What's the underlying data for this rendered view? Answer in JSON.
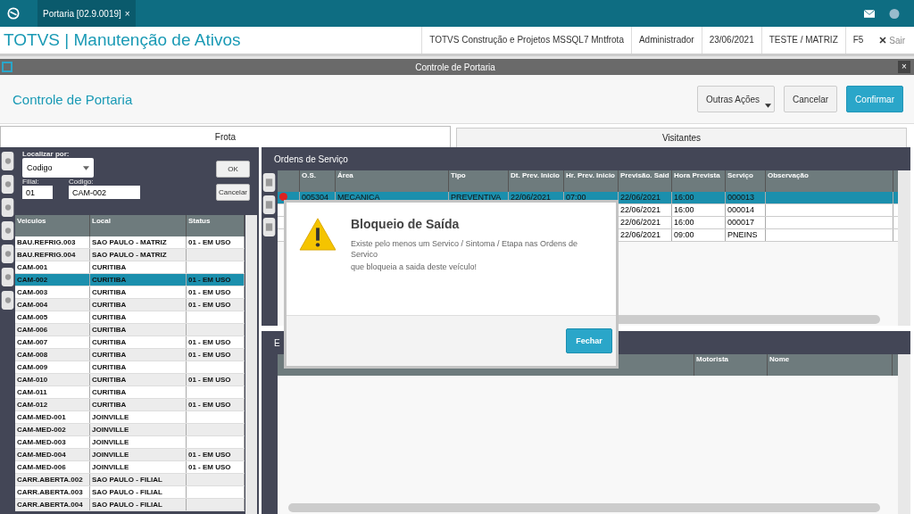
{
  "app_bar": {
    "tab": "Portaria [02.9.0019]",
    "tab_close": "×"
  },
  "header": {
    "title": "TOTVS | Manutenção de Ativos",
    "info": [
      "TOTVS Construção e Projetos MSSQL7 Mntfrota",
      "Administrador",
      "23/06/2021",
      "TESTE / MATRIZ",
      "F5"
    ],
    "exit": "Sair"
  },
  "window": {
    "title": "Controle de Portaria",
    "close": "×"
  },
  "toolbar": {
    "title": "Controle de Portaria",
    "buttons": [
      {
        "label": "Outras Ações",
        "kind": "menu"
      },
      {
        "label": "Cancelar",
        "kind": "plain"
      },
      {
        "label": "Confirmar",
        "kind": "primary"
      }
    ]
  },
  "tabs": [
    {
      "label": "Frota",
      "selected": true
    },
    {
      "label": "Visitantes",
      "selected": false
    }
  ],
  "search": {
    "label": "Localizar por:",
    "by": "Codigo",
    "filial_label": "Filial:",
    "filial": "01",
    "codigo_label": "Codigo:",
    "codigo": "CAM-002",
    "ok": "OK",
    "cancel": "Cancelar"
  },
  "vehicles": {
    "columns": [
      "Veiculos",
      "Local",
      "Status"
    ],
    "rows": [
      {
        "cells": [
          "BAU.REFRIG.003",
          "SAO PAULO - MATRIZ",
          "01 - EM USO"
        ],
        "selected": false
      },
      {
        "cells": [
          "BAU.REFRIG.004",
          "SAO PAULO - MATRIZ",
          ""
        ],
        "selected": false
      },
      {
        "cells": [
          "CAM-001",
          "CURITIBA",
          ""
        ],
        "selected": false
      },
      {
        "cells": [
          "CAM-002",
          "CURITIBA",
          "01 - EM USO"
        ],
        "selected": true
      },
      {
        "cells": [
          "CAM-003",
          "CURITIBA",
          "01 - EM USO"
        ],
        "selected": false
      },
      {
        "cells": [
          "CAM-004",
          "CURITIBA",
          "01 - EM USO"
        ],
        "selected": false
      },
      {
        "cells": [
          "CAM-005",
          "CURITIBA",
          ""
        ],
        "selected": false
      },
      {
        "cells": [
          "CAM-006",
          "CURITIBA",
          ""
        ],
        "selected": false
      },
      {
        "cells": [
          "CAM-007",
          "CURITIBA",
          "01 - EM USO"
        ],
        "selected": false
      },
      {
        "cells": [
          "CAM-008",
          "CURITIBA",
          "01 - EM USO"
        ],
        "selected": false
      },
      {
        "cells": [
          "CAM-009",
          "CURITIBA",
          ""
        ],
        "selected": false
      },
      {
        "cells": [
          "CAM-010",
          "CURITIBA",
          "01 - EM USO"
        ],
        "selected": false
      },
      {
        "cells": [
          "CAM-011",
          "CURITIBA",
          ""
        ],
        "selected": false
      },
      {
        "cells": [
          "CAM-012",
          "CURITIBA",
          "01 - EM USO"
        ],
        "selected": false
      },
      {
        "cells": [
          "CAM-MED-001",
          "JOINVILLE",
          ""
        ],
        "selected": false
      },
      {
        "cells": [
          "CAM-MED-002",
          "JOINVILLE",
          ""
        ],
        "selected": false
      },
      {
        "cells": [
          "CAM-MED-003",
          "JOINVILLE",
          ""
        ],
        "selected": false
      },
      {
        "cells": [
          "CAM-MED-004",
          "JOINVILLE",
          "01 - EM USO"
        ],
        "selected": false
      },
      {
        "cells": [
          "CAM-MED-006",
          "JOINVILLE",
          "01 - EM USO"
        ],
        "selected": false
      },
      {
        "cells": [
          "CARR.ABERTA.002",
          "SAO PAULO - FILIAL",
          ""
        ],
        "selected": false
      },
      {
        "cells": [
          "CARR.ABERTA.003",
          "SAO PAULO - FILIAL",
          ""
        ],
        "selected": false
      },
      {
        "cells": [
          "CARR.ABERTA.004",
          "SAO PAULO - FILIAL",
          ""
        ],
        "selected": false
      }
    ]
  },
  "orders": {
    "title": "Ordens de Serviço",
    "columns": [
      "O.S.",
      "Área",
      "Tipo",
      "Dt. Prev. Inicio",
      "Hr. Prev. Inicio",
      "Previsão. Said",
      "Hora Prevista",
      "Serviço",
      "Observação"
    ],
    "rows": [
      {
        "cells": [
          "005304",
          "MECANICA",
          "PREVENTIVA",
          "22/06/2021",
          "07:00",
          "22/06/2021",
          "16:00",
          "000013"
        ],
        "selected": true
      },
      {
        "cells": [
          "22/06/2021",
          "16:00",
          "000014"
        ],
        "selected": false
      },
      {
        "cells": [
          "22/06/2021",
          "16:00",
          "000017"
        ],
        "selected": false
      },
      {
        "cells": [
          "22/06/2021",
          "09:00",
          "PNEINS"
        ],
        "selected": false
      }
    ]
  },
  "entries": {
    "title": "E",
    "columns": [
      "Motorista",
      "Nome"
    ]
  },
  "dialog": {
    "title": "Bloqueio de Saída",
    "message": [
      "Existe pelo menos um Servico / Sintoma / Etapa nas Ordens de Servico",
      "que bloqueia a saida deste veículo!"
    ],
    "button": "Fechar"
  }
}
